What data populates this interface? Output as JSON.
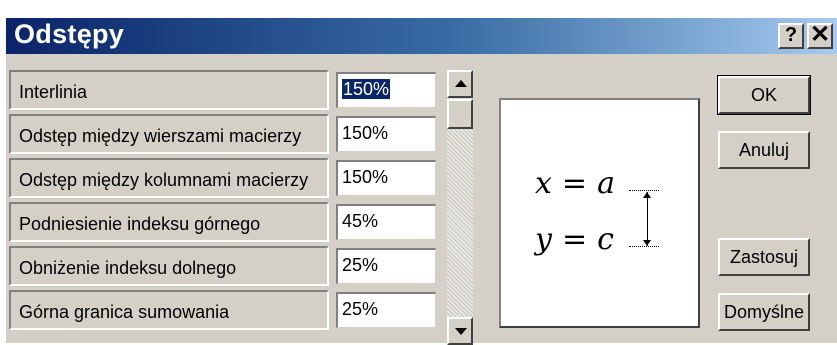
{
  "window": {
    "title": "Odstępy",
    "help_label": "?",
    "close_label": "✕"
  },
  "rows": [
    {
      "label": "Interlinia",
      "value": "150%",
      "selected": true
    },
    {
      "label": "Odstęp między wierszami macierzy",
      "value": "150%"
    },
    {
      "label": "Odstęp między kolumnami macierzy",
      "value": "150%"
    },
    {
      "label": "Podniesienie indeksu górnego",
      "value": "45%"
    },
    {
      "label": "Obniżenie indeksu dolnego",
      "value": "25%"
    },
    {
      "label": "Górna granica sumowania",
      "value": "25%"
    }
  ],
  "preview": {
    "eq1": {
      "lhs": "x",
      "op": "=",
      "rhs": "a"
    },
    "eq2": {
      "lhs": "y",
      "op": "=",
      "rhs": "c"
    }
  },
  "buttons": {
    "ok": "OK",
    "cancel": "Anuluj",
    "apply": "Zastosuj",
    "defaults": "Domyślne"
  },
  "icons": {
    "up": "scroll-up-arrow-icon",
    "down": "scroll-down-arrow-icon"
  }
}
